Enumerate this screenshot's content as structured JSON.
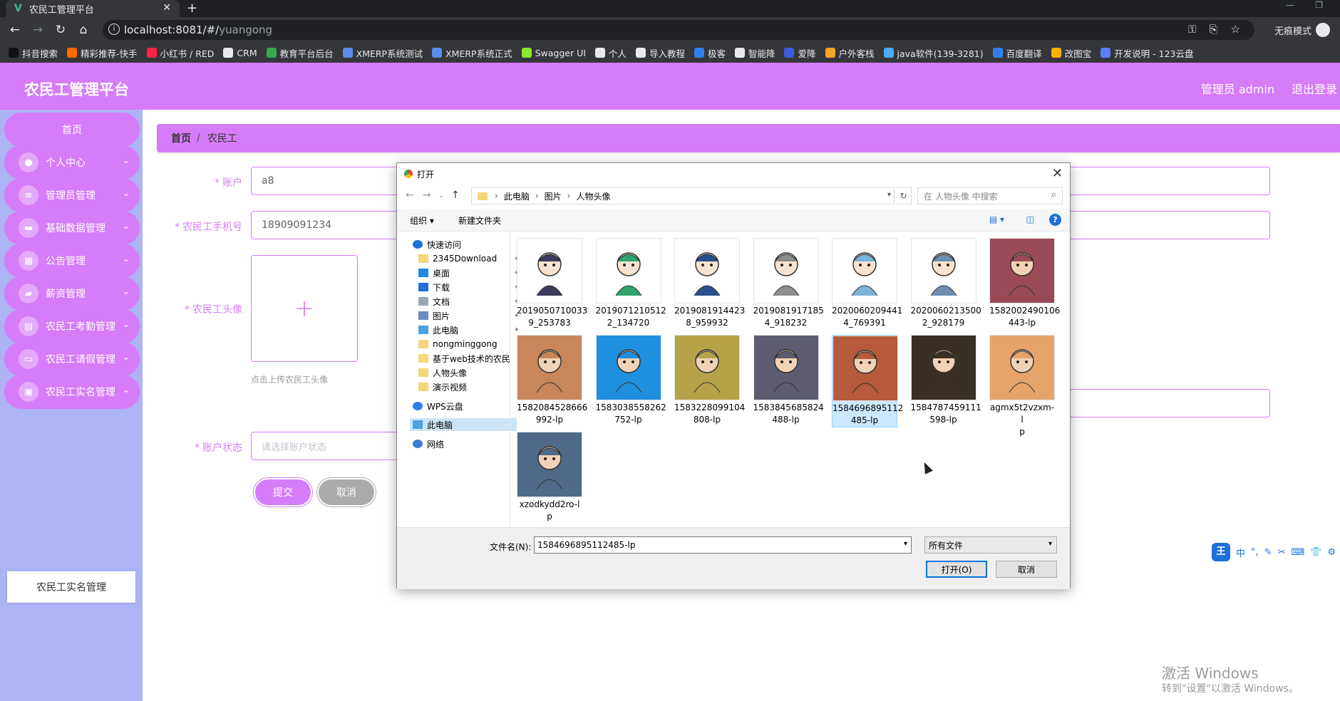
{
  "browser": {
    "tab_title": "农民工管理平台",
    "url_host": "localhost:8081/#/",
    "url_path": "yuangong",
    "incognito_label": "无痕模式",
    "bookmarks": [
      {
        "label": "抖音搜索",
        "color": "#111111"
      },
      {
        "label": "精彩推荐-快手",
        "color": "#ff6a00"
      },
      {
        "label": "小红书 / RED",
        "color": "#ff2442"
      },
      {
        "label": "CRM",
        "color": "#e8eaed"
      },
      {
        "label": "教育平台后台",
        "color": "#34a853"
      },
      {
        "label": "XMERP系统测试",
        "color": "#5b8def"
      },
      {
        "label": "XMERP系统正式",
        "color": "#5b8def"
      },
      {
        "label": "Swagger UI",
        "color": "#85ea2d"
      },
      {
        "label": "个人",
        "color": "#e8eaed"
      },
      {
        "label": "导入教程",
        "color": "#e8eaed"
      },
      {
        "label": "极客",
        "color": "#2f80ed"
      },
      {
        "label": "智能降",
        "color": "#e8eaed"
      },
      {
        "label": "爱降",
        "color": "#3b5bdb"
      },
      {
        "label": "户外客栈",
        "color": "#f5a623"
      },
      {
        "label": "java软件(139-3281)",
        "color": "#4dabf7"
      },
      {
        "label": "百度翻译",
        "color": "#2f80ed"
      },
      {
        "label": "改图宝",
        "color": "#fab005"
      },
      {
        "label": "开发说明 - 123云盘",
        "color": "#5c7cfa"
      }
    ]
  },
  "header": {
    "title": "农民工管理平台",
    "admin": "管理员 admin",
    "logout": "退出登录"
  },
  "sidebar": {
    "home": "首页",
    "items": [
      {
        "label": "个人中心",
        "icon": "user-icon"
      },
      {
        "label": "管理员管理",
        "icon": "sliders-icon"
      },
      {
        "label": "基础数据管理",
        "icon": "ticket-icon"
      },
      {
        "label": "公告管理",
        "icon": "grid-icon"
      },
      {
        "label": "薪资管理",
        "icon": "briefcase-icon"
      },
      {
        "label": "农民工考勤管理",
        "icon": "clipboard-icon"
      },
      {
        "label": "农民工请假管理",
        "icon": "monitor-icon"
      },
      {
        "label": "农民工实名管理",
        "icon": "screen-icon"
      }
    ],
    "sub_item": "农民工实名管理"
  },
  "breadcrumb": {
    "home": "首页",
    "sep": "/",
    "current": "农民工"
  },
  "form": {
    "account_label": "账户",
    "account_value": "a8",
    "phone_label": "农民工手机号",
    "phone_value": "18909091234",
    "avatar_label": "农民工头像",
    "upload_tip": "点击上传农民工头像",
    "status_label": "账户状态",
    "status_placeholder": "请选择账户状态",
    "submit": "提交",
    "cancel": "取消"
  },
  "dialog": {
    "title": "打开",
    "path": [
      "此电脑",
      "图片",
      "人物头像"
    ],
    "search_placeholder": "在 人物头像 中搜索",
    "organize": "组织 ▾",
    "new_folder": "新建文件夹",
    "tree": [
      {
        "label": "快速访问",
        "icon": "star-icon",
        "pinned": false
      },
      {
        "label": "2345Download",
        "icon": "folder-icon",
        "pinned": true
      },
      {
        "label": "桌面",
        "icon": "desktop-icon",
        "pinned": true
      },
      {
        "label": "下载",
        "icon": "download-icon",
        "pinned": true
      },
      {
        "label": "文档",
        "icon": "document-icon",
        "pinned": true
      },
      {
        "label": "图片",
        "icon": "picture-icon",
        "pinned": true
      },
      {
        "label": "此电脑",
        "icon": "computer-icon",
        "pinned": true
      },
      {
        "label": "nongminggong",
        "icon": "folder-icon",
        "pinned": false
      },
      {
        "label": "基于web技术的农民",
        "icon": "folder-icon",
        "pinned": false
      },
      {
        "label": "人物头像",
        "icon": "folder-icon",
        "pinned": false
      },
      {
        "label": "演示视频",
        "icon": "folder-icon",
        "pinned": false
      },
      {
        "label": "WPS云盘",
        "icon": "cloud-icon",
        "pinned": false
      },
      {
        "label": "此电脑",
        "icon": "computer-icon",
        "pinned": false
      },
      {
        "label": "网络",
        "icon": "network-icon",
        "pinned": false
      }
    ],
    "files": [
      {
        "line1": "2019050710033",
        "line2": "9_253783",
        "color": "#3b3b5c"
      },
      {
        "line1": "2019071210512",
        "line2": "2_134720",
        "color": "#2ea56b"
      },
      {
        "line1": "2019081914423",
        "line2": "8_959932",
        "color": "#2a4f8f"
      },
      {
        "line1": "2019081917185",
        "line2": "4_918232",
        "color": "#8d8d8d"
      },
      {
        "line1": "2020060209441",
        "line2": "4_769391",
        "color": "#7bb3d8"
      },
      {
        "line1": "2020060213500",
        "line2": "2_928179",
        "color": "#6f8fb0"
      },
      {
        "line1": "1582002490106",
        "line2": "443-lp",
        "color": "#9a4a57"
      },
      {
        "line1": "1582084528666",
        "line2": "992-lp",
        "color": "#c8865a"
      },
      {
        "line1": "1583038558262",
        "line2": "752-lp",
        "color": "#1f8fe0"
      },
      {
        "line1": "1583228099104",
        "line2": "808-lp",
        "color": "#b7a24a"
      },
      {
        "line1": "1583845685824",
        "line2": "488-lp",
        "color": "#5c5c6e"
      },
      {
        "line1": "1584696895112",
        "line2": "485-lp",
        "color": "#b55a3c"
      },
      {
        "line1": "1584787459111",
        "line2": "598-lp",
        "color": "#3a3022"
      },
      {
        "line1": "agmx5t2vzxm-l",
        "line2": "p",
        "color": "#e6a46a"
      },
      {
        "line1": "xzodkydd2ro-l",
        "line2": "p",
        "color": "#4e6a88"
      }
    ],
    "filename_label": "文件名(N):",
    "filename_value": "1584696895112485-lp",
    "filetype_value": "所有文件",
    "open_button": "打开(O)",
    "cancel_button": "取消"
  },
  "ime": {
    "king": "王",
    "items": [
      "中",
      "°,",
      "✎",
      "✂",
      "⌨",
      "👕",
      "⚙"
    ]
  },
  "watermark": {
    "line1": "激活 Windows",
    "line2": "转到\"设置\"以激活 Windows。"
  }
}
